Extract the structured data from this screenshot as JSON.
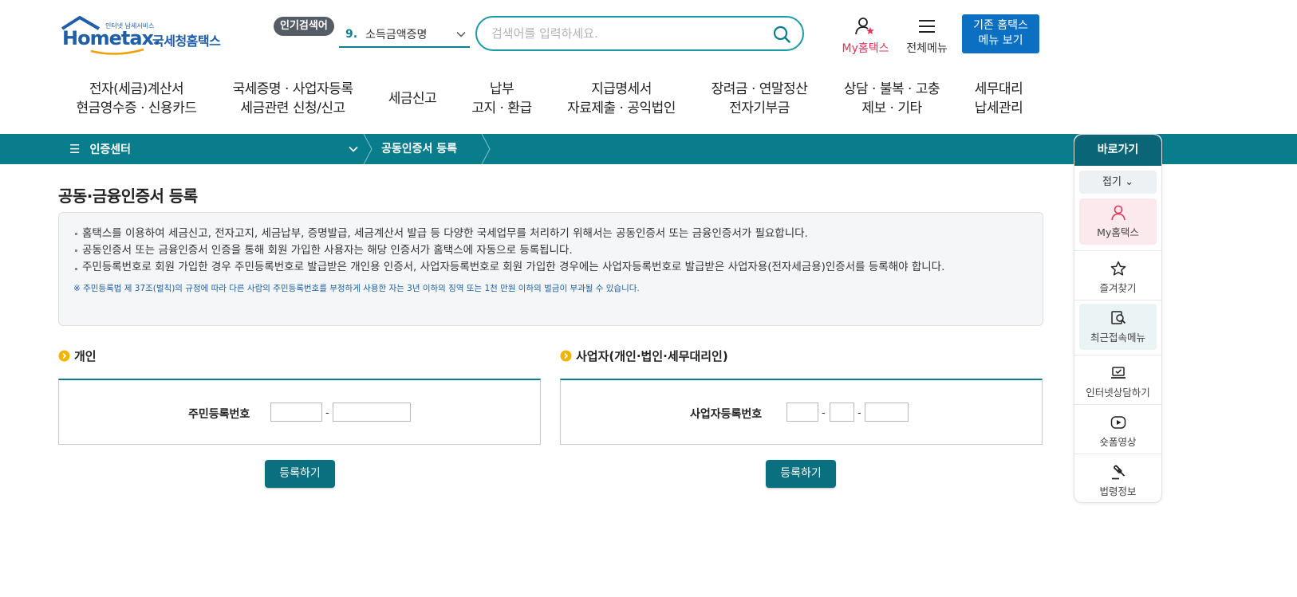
{
  "header": {
    "logo": {
      "brand": "Hometax.",
      "tagline": "인터넷 납세서비스",
      "name": "국세청홈택스"
    },
    "popular": {
      "badge": "인기검색어",
      "rank": "9.",
      "keyword": "소득금액증명"
    },
    "search": {
      "placeholder": "검색어를 입력하세요."
    },
    "my_hometax_label": "My홈택스",
    "all_menu_label": "전체메뉴",
    "old_menu_button": {
      "line1": "기존 홈택스",
      "line2": "메뉴 보기"
    }
  },
  "gnb": [
    {
      "line1": "전자(세금)계산서",
      "line2": "현금영수증 · 신용카드"
    },
    {
      "line1": "국세증명 · 사업자등록",
      "line2": "세금관련 신청/신고"
    },
    {
      "line1": "세금신고",
      "line2": ""
    },
    {
      "line1": "납부",
      "line2": "고지 · 환급"
    },
    {
      "line1": "지급명세서",
      "line2": "자료제출 · 공익법인"
    },
    {
      "line1": "장려금 · 연말정산",
      "line2": "전자기부금"
    },
    {
      "line1": "상담 · 불복 · 고충",
      "line2": "제보 · 기타"
    },
    {
      "line1": "세무대리",
      "line2": "납세관리"
    }
  ],
  "location": {
    "center": "인증센터",
    "current": "공동인증서 등록"
  },
  "quick_menu": {
    "title": "바로가기",
    "fold": "접기",
    "items": [
      {
        "label": "My홈택스",
        "icon": "person-icon"
      },
      {
        "label": "즐겨찾기",
        "icon": "star-icon"
      },
      {
        "label": "최근접속메뉴",
        "icon": "recent-search-icon"
      },
      {
        "label": "인터넷상담하기",
        "icon": "laptop-check-icon"
      },
      {
        "label": "숏폼영상",
        "icon": "play-icon"
      },
      {
        "label": "법령정보",
        "icon": "gavel-icon"
      }
    ]
  },
  "page": {
    "title": "공동·금융인증서 등록",
    "info": [
      "홈택스를 이용하여 세금신고, 전자고지, 세금납부, 증명발급, 세금계산서 발급 등 다양한 국세업무를 처리하기 위해서는 공동인증서 또는 금융인증서가 필요합니다.",
      "공동인증서 또는 금융인증서 인증을 통해 회원 가입한 사용자는 해당 인증서가 홈택스에 자동으로 등록됩니다.",
      "주민등록번호로 회원 가입한 경우 주민등록번호로 발급받은 개인용 인증서, 사업자등록번호로 회원 가입한 경우에는 사업자등록번호로 발급받은 사업자용(전자세금용)인증서를 등록해야 합니다."
    ],
    "note": "※ 주민등록법 제 37조(벌칙)의 규정에 따라 다른 사람의 주민등록번호를 부정하게 사용한 자는 3년 이하의 징역 또는 1천 만원 이하의 벌금이 부과될 수 있습니다.",
    "individual": {
      "title": "개인",
      "field_label": "주민등록번호",
      "rrn_front": "",
      "rrn_back": "",
      "dash": "-",
      "button": "등록하기"
    },
    "business": {
      "title": "사업자(개인·법인·세무대리인)",
      "field_label": "사업자등록번호",
      "brn_1": "",
      "brn_2": "",
      "brn_3": "",
      "dash": "-",
      "button": "등록하기"
    }
  },
  "colors": {
    "teal": "#0a7d8c",
    "brand_blue": "#1f5faa",
    "accent_pink": "#e0345a",
    "button_blue": "#0b6fc2",
    "note_blue": "#1d5fa0"
  }
}
